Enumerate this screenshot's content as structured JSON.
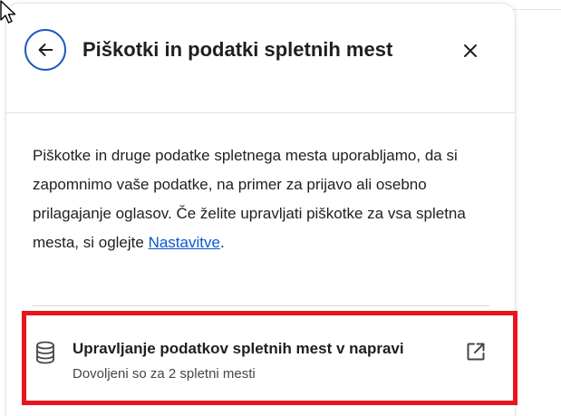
{
  "dialog": {
    "title": "Piškotki in podatki spletnih mest",
    "description_before_link": "Piškotke in druge podatke spletnega mesta uporabljamo, da si zapomnimo vaše podatke, na primer za prijavo ali osebno prilagajanje oglasov. Če želite upravljati piškotke za vsa spletna mesta, si oglejte ",
    "settings_link": "Nastavitve",
    "description_after_link": ".",
    "manage_item": {
      "title": "Upravljanje podatkov spletnih mest v napravi",
      "subtitle": "Dovoljeni so za 2 spletni mesti"
    }
  },
  "icons": {
    "back": "back-arrow-icon",
    "close": "close-icon",
    "database": "database-icon",
    "external": "open-in-new-icon",
    "cursor": "mouse-cursor-icon"
  },
  "colors": {
    "accent": "#1f57c3",
    "link": "#0b57d0",
    "text": "#1f1f1f",
    "subtext": "#444746",
    "highlight": "#e8141e"
  }
}
